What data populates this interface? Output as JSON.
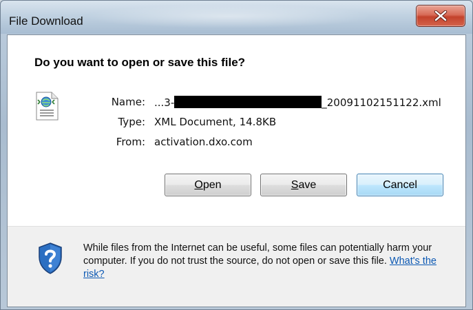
{
  "window": {
    "title": "File Download"
  },
  "dialog": {
    "question": "Do you want to open or save this file?",
    "file": {
      "name_label": "Name:",
      "name_prefix": "...3-",
      "name_suffix": "_20091102151122.xml",
      "type_label": "Type:",
      "type_value": "XML Document, 14.8KB",
      "from_label": "From:",
      "from_value": "activation.dxo.com"
    },
    "buttons": {
      "open_mnemonic": "O",
      "open_rest": "pen",
      "save_mnemonic": "S",
      "save_rest": "ave",
      "cancel": "Cancel"
    },
    "footer": {
      "warning_text": "While files from the Internet can be useful, some files can potentially harm your computer. If you do not trust the source, do not open or save this file. ",
      "risk_link": "What's the risk?"
    }
  },
  "icons": {
    "file": "xml-file-icon",
    "shield": "shield-question-icon",
    "close": "close-icon"
  },
  "colors": {
    "close_button": "#c3422c",
    "default_button_border": "#3c7fb1",
    "link": "#0b58b3"
  }
}
